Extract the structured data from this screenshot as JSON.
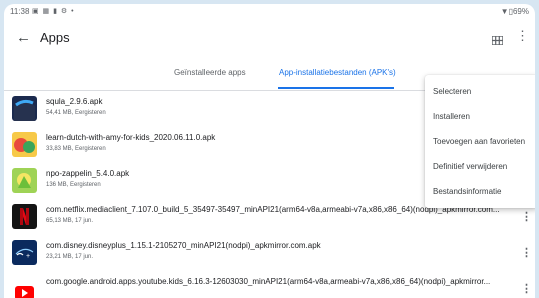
{
  "status_bar": {
    "time": "11:38",
    "icons": "▣ ▦ ▮ ⚙ •",
    "right": "▼▯69%"
  },
  "app_bar": {
    "title": "Apps",
    "back_glyph": "←",
    "more_glyph": "⋮"
  },
  "tabs": [
    {
      "label": "Geïnstalleerde apps",
      "selected": false
    },
    {
      "label": "App-installatiebestanden (APK's)",
      "selected": true
    }
  ],
  "files": [
    {
      "name": "squla_2.9.6.apk",
      "meta": "54,41 MB, Eergisteren",
      "icon": "squla-app-icon"
    },
    {
      "name": "learn-dutch-with-amy-for-kids_2020.06.11.0.apk",
      "meta": "33,83 MB, Eergisteren",
      "icon": "learn-dutch-amy-app-icon"
    },
    {
      "name": "npo-zappelin_5.4.0.apk",
      "meta": "136 MB, Eergisteren",
      "icon": "npo-zappelin-app-icon"
    },
    {
      "name": "com.netflix.mediaclient_7.107.0_build_5_35497-35497_minAPI21(arm64-v8a,armeabi-v7a,x86,x86_64)(nodpi)_apkmirror.com...",
      "meta": "65,13 MB, 17 jun.",
      "icon": "netflix-app-icon"
    },
    {
      "name": "com.disney.disneyplus_1.15.1-2105270_minAPI21(nodpi)_apkmirror.com.apk",
      "meta": "23,21 MB, 17 jun.",
      "icon": "disneyplus-app-icon"
    },
    {
      "name": "com.google.android.apps.youtube.kids_6.16.3-12603030_minAPI21(arm64-v8a,armeabi-v7a,x86,x86_64)(nodpi)_apkmirror...",
      "meta": "",
      "icon": "youtube-kids-app-icon"
    }
  ],
  "context_menu": {
    "items": [
      "Selecteren",
      "Installeren",
      "Toevoegen aan favorieten",
      "Definitief verwijderen",
      "Bestandsinformatie"
    ]
  },
  "colors": {
    "accent": "#1a73e8",
    "netflix": "#e50914",
    "disney": "#0b2a5e",
    "youtube": "#ff0000",
    "squla": "#1b2a4e"
  }
}
